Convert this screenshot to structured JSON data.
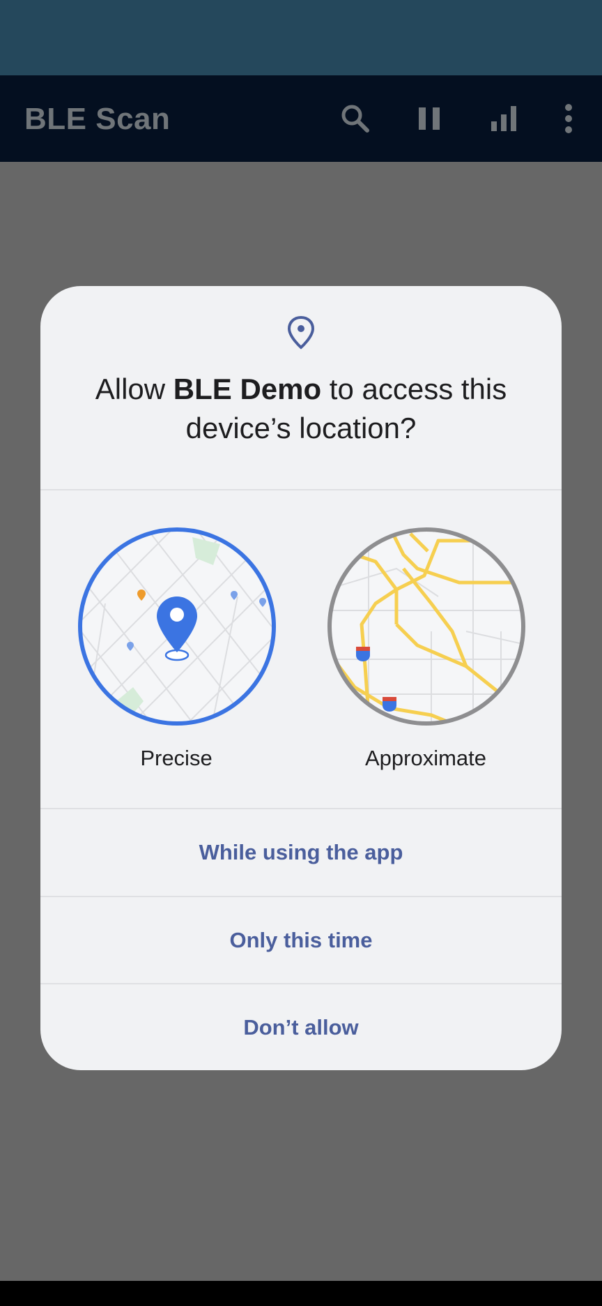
{
  "app_bar": {
    "title": "BLE Scan",
    "actions": [
      "search-icon",
      "pause-icon",
      "signal-icon",
      "more-vert-icon"
    ]
  },
  "dialog": {
    "icon": "location-pin-icon",
    "title_prefix": "Allow ",
    "title_app": "BLE Demo",
    "title_suffix": " to access this device’s location?",
    "options": {
      "precise_label": "Precise",
      "approximate_label": "Approximate"
    },
    "buttons": {
      "while_using": "While using the app",
      "only_this_time": "Only this time",
      "dont_allow": "Don’t allow"
    }
  },
  "colors": {
    "status_bar": "#25485c",
    "app_bar": "#040f20",
    "scrim": "#676767",
    "dialog_bg": "#f1f2f4",
    "accent_blue": "#3b74e2",
    "button_text": "#4a5e9c",
    "road_yellow": "#f6cf50",
    "ring_gray": "#8e8e90"
  }
}
